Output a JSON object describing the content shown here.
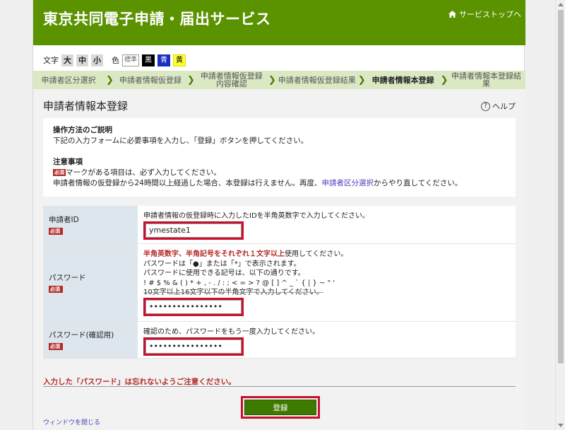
{
  "header": {
    "title": "東京共同電子申請・届出サービス",
    "top_link": "サービストップへ"
  },
  "accessibility": {
    "text_label": "文字",
    "sizes": [
      "大",
      "中",
      "小"
    ],
    "color_label": "色",
    "colors": [
      "標準",
      "黒",
      "青",
      "黄"
    ]
  },
  "steps": [
    {
      "label": "申請者区分選択",
      "active": false
    },
    {
      "label": "申請者情報仮登録",
      "active": false
    },
    {
      "label": "申請者情報仮登録内容確認",
      "active": false
    },
    {
      "label": "申請者情報仮登録結果",
      "active": false
    },
    {
      "label": "申請者情報本登録",
      "active": true
    },
    {
      "label": "申請者情報本登録結果",
      "active": false
    }
  ],
  "page": {
    "heading": "申請者情報本登録",
    "help": "ヘルプ"
  },
  "info": {
    "ops_title": "操作方法のご説明",
    "ops_text": "下記の入力フォームに必要事項を入力し、「登録」ボタンを押してください。",
    "notes_title": "注意事項",
    "req_badge": "必須",
    "notes_line1": "マークがある項目は、必ず入力してください。",
    "notes_line2_a": "申請者情報の仮登録から24時間以上経過した場合、本登録は行えません。再度、",
    "notes_line2_link": "申請者区分選択",
    "notes_line2_b": "からやり直してください。"
  },
  "form": {
    "id": {
      "label": "申請者ID",
      "hint": "申請者情報の仮登録時に入力したIDを半角英数字で入力してください。",
      "value": "ymestate1"
    },
    "password": {
      "label": "パスワード",
      "hint_strong": "半角英数字、半角記号をそれぞれ１文字以上",
      "hint_strong_suffix": "使用してください。",
      "hint2": "パスワードは「●」または「*」で表示されます。",
      "hint3": "パスワードに使用できる記号は、以下の通りです。",
      "symbols": "! # $ % & ( ) * + , - . / : ; < = > ? @ [ ] ^ _ ` { | } ~ \" '",
      "hint4": "10文字以上16文字以下の半角文字で入力してください。",
      "value": "••••••••••••••••"
    },
    "password_confirm": {
      "label": "パスワード(確認用)",
      "hint": "確認のため、パスワードをもう一度入力してください。",
      "value": "••••••••••••••••"
    }
  },
  "warning": "入力した「パスワード」は忘れないようご注意ください。",
  "submit_label": "登録",
  "close_label": "ウィンドウを閉じる"
}
